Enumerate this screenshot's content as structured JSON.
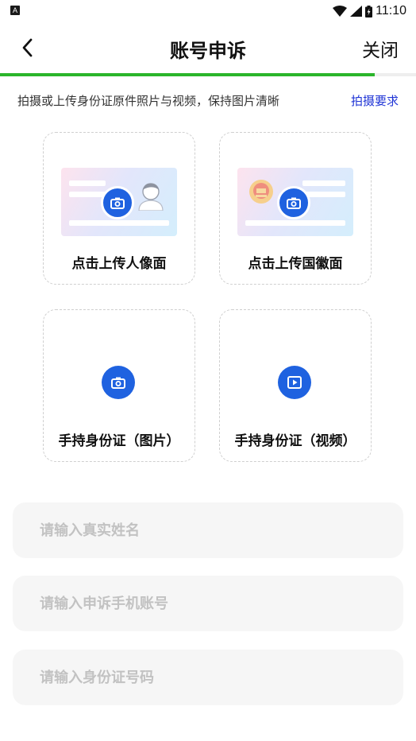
{
  "status_bar": {
    "time": "11:10",
    "left_badge": "A"
  },
  "header": {
    "title": "账号申诉",
    "close_label": "关闭",
    "progress": 0.9,
    "accent_color": "#2bb52b"
  },
  "hint": {
    "text": "拍摄或上传身份证原件照片与视频，保持图片清晰",
    "link_label": "拍摄要求",
    "link_color": "#2136d6"
  },
  "uploads": {
    "portrait_label": "点击上传人像面",
    "emblem_label": "点击上传国徽面",
    "handheld_photo_label": "手持身份证（图片）",
    "handheld_video_label": "手持身份证（视频）",
    "icon_color": "#1f62e0"
  },
  "form": {
    "name_placeholder": "请输入真实姓名",
    "account_placeholder": "请输入申诉手机账号",
    "id_placeholder": "请输入身份证号码"
  }
}
